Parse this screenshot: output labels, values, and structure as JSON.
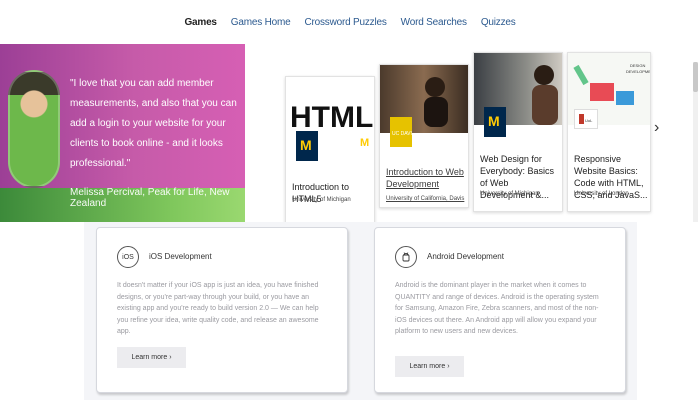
{
  "nav": {
    "items": [
      {
        "label": "Games",
        "active": true
      },
      {
        "label": "Games Home",
        "active": false
      },
      {
        "label": "Crossword Puzzles",
        "active": false
      },
      {
        "label": "Word Searches",
        "active": false
      },
      {
        "label": "Quizzes",
        "active": false
      }
    ]
  },
  "testimonial": {
    "quote": "\"I love that you can add member measurements, and also that you can add a login to your website for your clients to book online - and it looks professional.\"",
    "attribution": "Melissa Percival, Peak for Life, New Zealand"
  },
  "courses": [
    {
      "thumb_text": "HTML",
      "title": "Introduction to HTML5",
      "org": "University of Michigan",
      "logo": "michigan-logo",
      "linked": false
    },
    {
      "thumb_text": "",
      "title": "Introduction to Web Development",
      "org": "University of California, Davis",
      "logo": "uc-davis-logo",
      "linked": true
    },
    {
      "thumb_text": "",
      "title": "Web Design for Everybody: Basics of Web Development &...",
      "org": "University of Michigan",
      "logo": "michigan-logo",
      "linked": false
    },
    {
      "thumb_text": "DESIGN DEVELOPMENT",
      "title": "Responsive Website Basics: Code with HTML, CSS, and JavaS...",
      "org": "University of London",
      "logo": "london-logo",
      "linked": false
    }
  ],
  "services": [
    {
      "icon_label": "iOS",
      "icon": "ios-icon",
      "heading": "iOS Development",
      "description": "It doesn't matter if your iOS app is just an idea, you have finished designs, or you're part-way through your build, or you have an existing app and you're ready to build version 2.0 — We can help you refine your idea, write quality code, and release an awesome app.",
      "button": "Learn more ›"
    },
    {
      "icon_label": "",
      "icon": "android-icon",
      "heading": "Android Development",
      "description": "Android is the dominant player in the market when it comes to QUANTITY and range of devices. Android is the operating system for Samsung, Amazon Fire, Zebra scanners, and most of the non-iOS devices out there. An Android app will allow you expand your platform to new users and new devices.",
      "button": "Learn more ›"
    }
  ],
  "colors": {
    "banner_purple": "#c65ba9",
    "michigan_blue": "#00274c",
    "michigan_maize": "#ffcb05",
    "nav_link": "#2c5a8f"
  }
}
